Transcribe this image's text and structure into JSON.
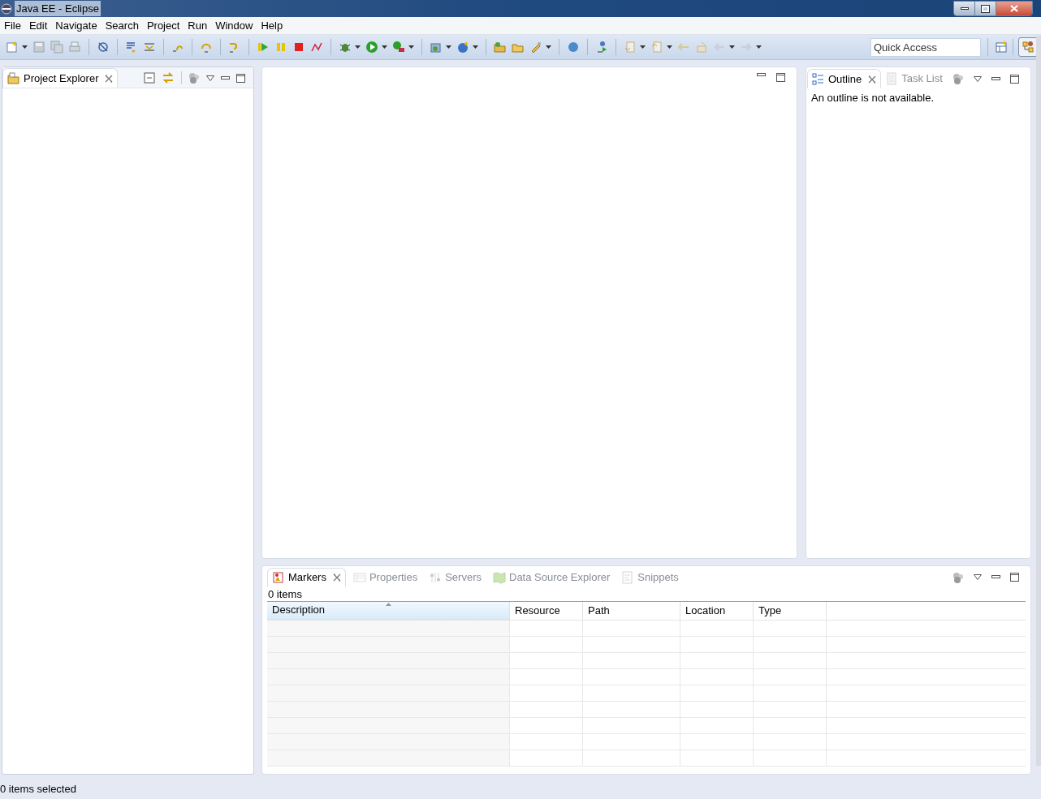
{
  "window": {
    "title": "Java EE - Eclipse"
  },
  "menu": [
    "File",
    "Edit",
    "Navigate",
    "Search",
    "Project",
    "Run",
    "Window",
    "Help"
  ],
  "quick_access": {
    "placeholder": "Quick Access"
  },
  "left_panel": {
    "tabs": [
      {
        "label": "Project Explorer",
        "selected": true
      }
    ]
  },
  "outline_panel": {
    "tabs": [
      {
        "label": "Outline",
        "selected": true
      },
      {
        "label": "Task List",
        "selected": false
      }
    ],
    "message": "An outline is not available."
  },
  "bottom_panel": {
    "tabs": [
      {
        "label": "Markers",
        "selected": true
      },
      {
        "label": "Properties",
        "selected": false
      },
      {
        "label": "Servers",
        "selected": false
      },
      {
        "label": "Data Source Explorer",
        "selected": false
      },
      {
        "label": "Snippets",
        "selected": false
      }
    ],
    "count": "0 items",
    "table": {
      "columns": [
        {
          "label": "Description",
          "sorted": true
        },
        {
          "label": "Resource",
          "sorted": false
        },
        {
          "label": "Path",
          "sorted": false
        },
        {
          "label": "Location",
          "sorted": false
        },
        {
          "label": "Type",
          "sorted": false
        }
      ]
    }
  },
  "status_bar": "0 items selected"
}
